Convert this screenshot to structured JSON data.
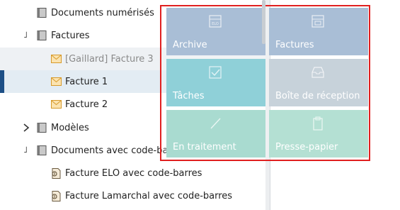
{
  "tree": {
    "items": [
      {
        "label": "Documents numérisés",
        "icon": "document-gray-icon"
      },
      {
        "label": "Factures",
        "icon": "folder-icon",
        "toggle": "collapse"
      },
      {
        "label": "[Gaillard] Facture 3",
        "icon": "envelope-icon",
        "muted": true
      },
      {
        "label": "Facture 1",
        "icon": "envelope-icon",
        "selected": true
      },
      {
        "label": "Facture 2",
        "icon": "envelope-icon"
      },
      {
        "label": "Modèles",
        "icon": "folder-icon",
        "toggle": "expand"
      },
      {
        "label": "Documents avec code-barres",
        "icon": "folder-icon",
        "toggle": "collapse"
      },
      {
        "label": "Facture ELO avec code-barres",
        "icon": "barcode-document-icon"
      },
      {
        "label": "Facture Lamarchal avec code-barres",
        "icon": "barcode-document-icon"
      }
    ]
  },
  "tiles": [
    {
      "label": "Archive",
      "icon": "archive-icon",
      "color": "#a9bed6"
    },
    {
      "label": "Factures",
      "icon": "invoices-icon",
      "color": "#a9bed6"
    },
    {
      "label": "Tâches",
      "icon": "check-icon",
      "color": "#8fd0d8"
    },
    {
      "label": "Boîte de réception",
      "icon": "inbox-icon",
      "color": "#c7d2da"
    },
    {
      "label": "En traitement",
      "icon": "pen-icon",
      "color": "#a9dbd0"
    },
    {
      "label": "Presse-papier",
      "icon": "clipboard-icon",
      "color": "#b4e0d3"
    }
  ],
  "colors": {
    "overlay_border": "#e02020",
    "selected_row": "#e3ecf3",
    "selection_bar": "#1d4f86"
  }
}
